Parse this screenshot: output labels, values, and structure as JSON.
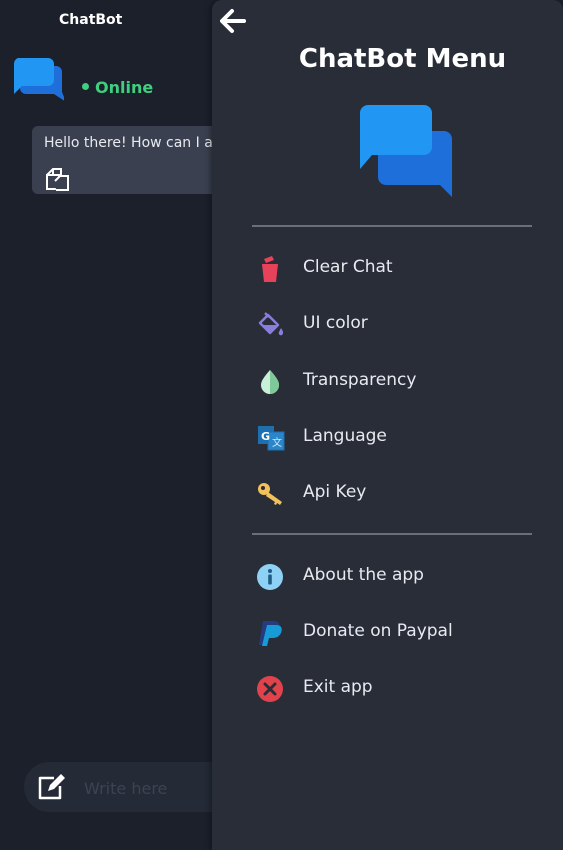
{
  "app": {
    "title": "ChatBot",
    "status": "Online",
    "message": "Hello there! How can I assist you today?",
    "input_placeholder": "Write here"
  },
  "drawer": {
    "title": "ChatBot Menu",
    "items": [
      {
        "label": "Clear Chat",
        "icon": "trash-icon"
      },
      {
        "label": "UI color",
        "icon": "paint-bucket-icon"
      },
      {
        "label": "Transparency",
        "icon": "droplet-icon"
      },
      {
        "label": "Language",
        "icon": "translate-icon"
      },
      {
        "label": "Api Key",
        "icon": "key-icon"
      },
      {
        "label": "About the app",
        "icon": "info-icon"
      },
      {
        "label": "Donate on Paypal",
        "icon": "paypal-icon"
      },
      {
        "label": "Exit app",
        "icon": "close-circle-icon"
      }
    ]
  },
  "colors": {
    "background": "#1b202a",
    "drawer": "#292d38",
    "status_green": "#3fcf7e",
    "bubble": "#3a4050",
    "logo_blue": "#2196f3"
  }
}
